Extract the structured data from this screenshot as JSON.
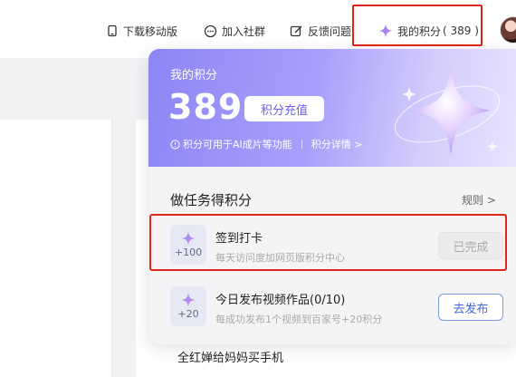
{
  "topbar": {
    "mobile_label": "下载移动版",
    "community_label": "加入社群",
    "feedback_label": "反馈问题",
    "points_label": "我的积分",
    "points_count": "( 389 )"
  },
  "hero": {
    "title": "我的积分",
    "points_value": "389",
    "recharge_label": "积分充值",
    "note": "积分可用于AI成片等功能",
    "detail_link": "积分详情 >"
  },
  "tasks_section": {
    "title": "做任务得积分",
    "rules_link": "规则 >",
    "tasks": [
      {
        "reward": "+100",
        "name": "签到打卡",
        "desc": "每天访问度加网页版积分中心",
        "button": "已完成",
        "status": "done"
      },
      {
        "reward": "+20",
        "name": "今日发布视频作品(0/10)",
        "desc": "每成功发布1个视频到百家号+20积分",
        "button": "去发布",
        "status": "todo"
      }
    ]
  },
  "background": {
    "feed_line": "全红婵给妈妈买手机"
  },
  "colors": {
    "accent_purple": "#8c86f6",
    "highlight_red": "#e1251b",
    "publish_blue": "#3d69d8"
  },
  "icons": {
    "mobile": "phone-icon",
    "community": "chat-icon",
    "feedback": "edit-icon",
    "points": "sparkle-icon"
  }
}
